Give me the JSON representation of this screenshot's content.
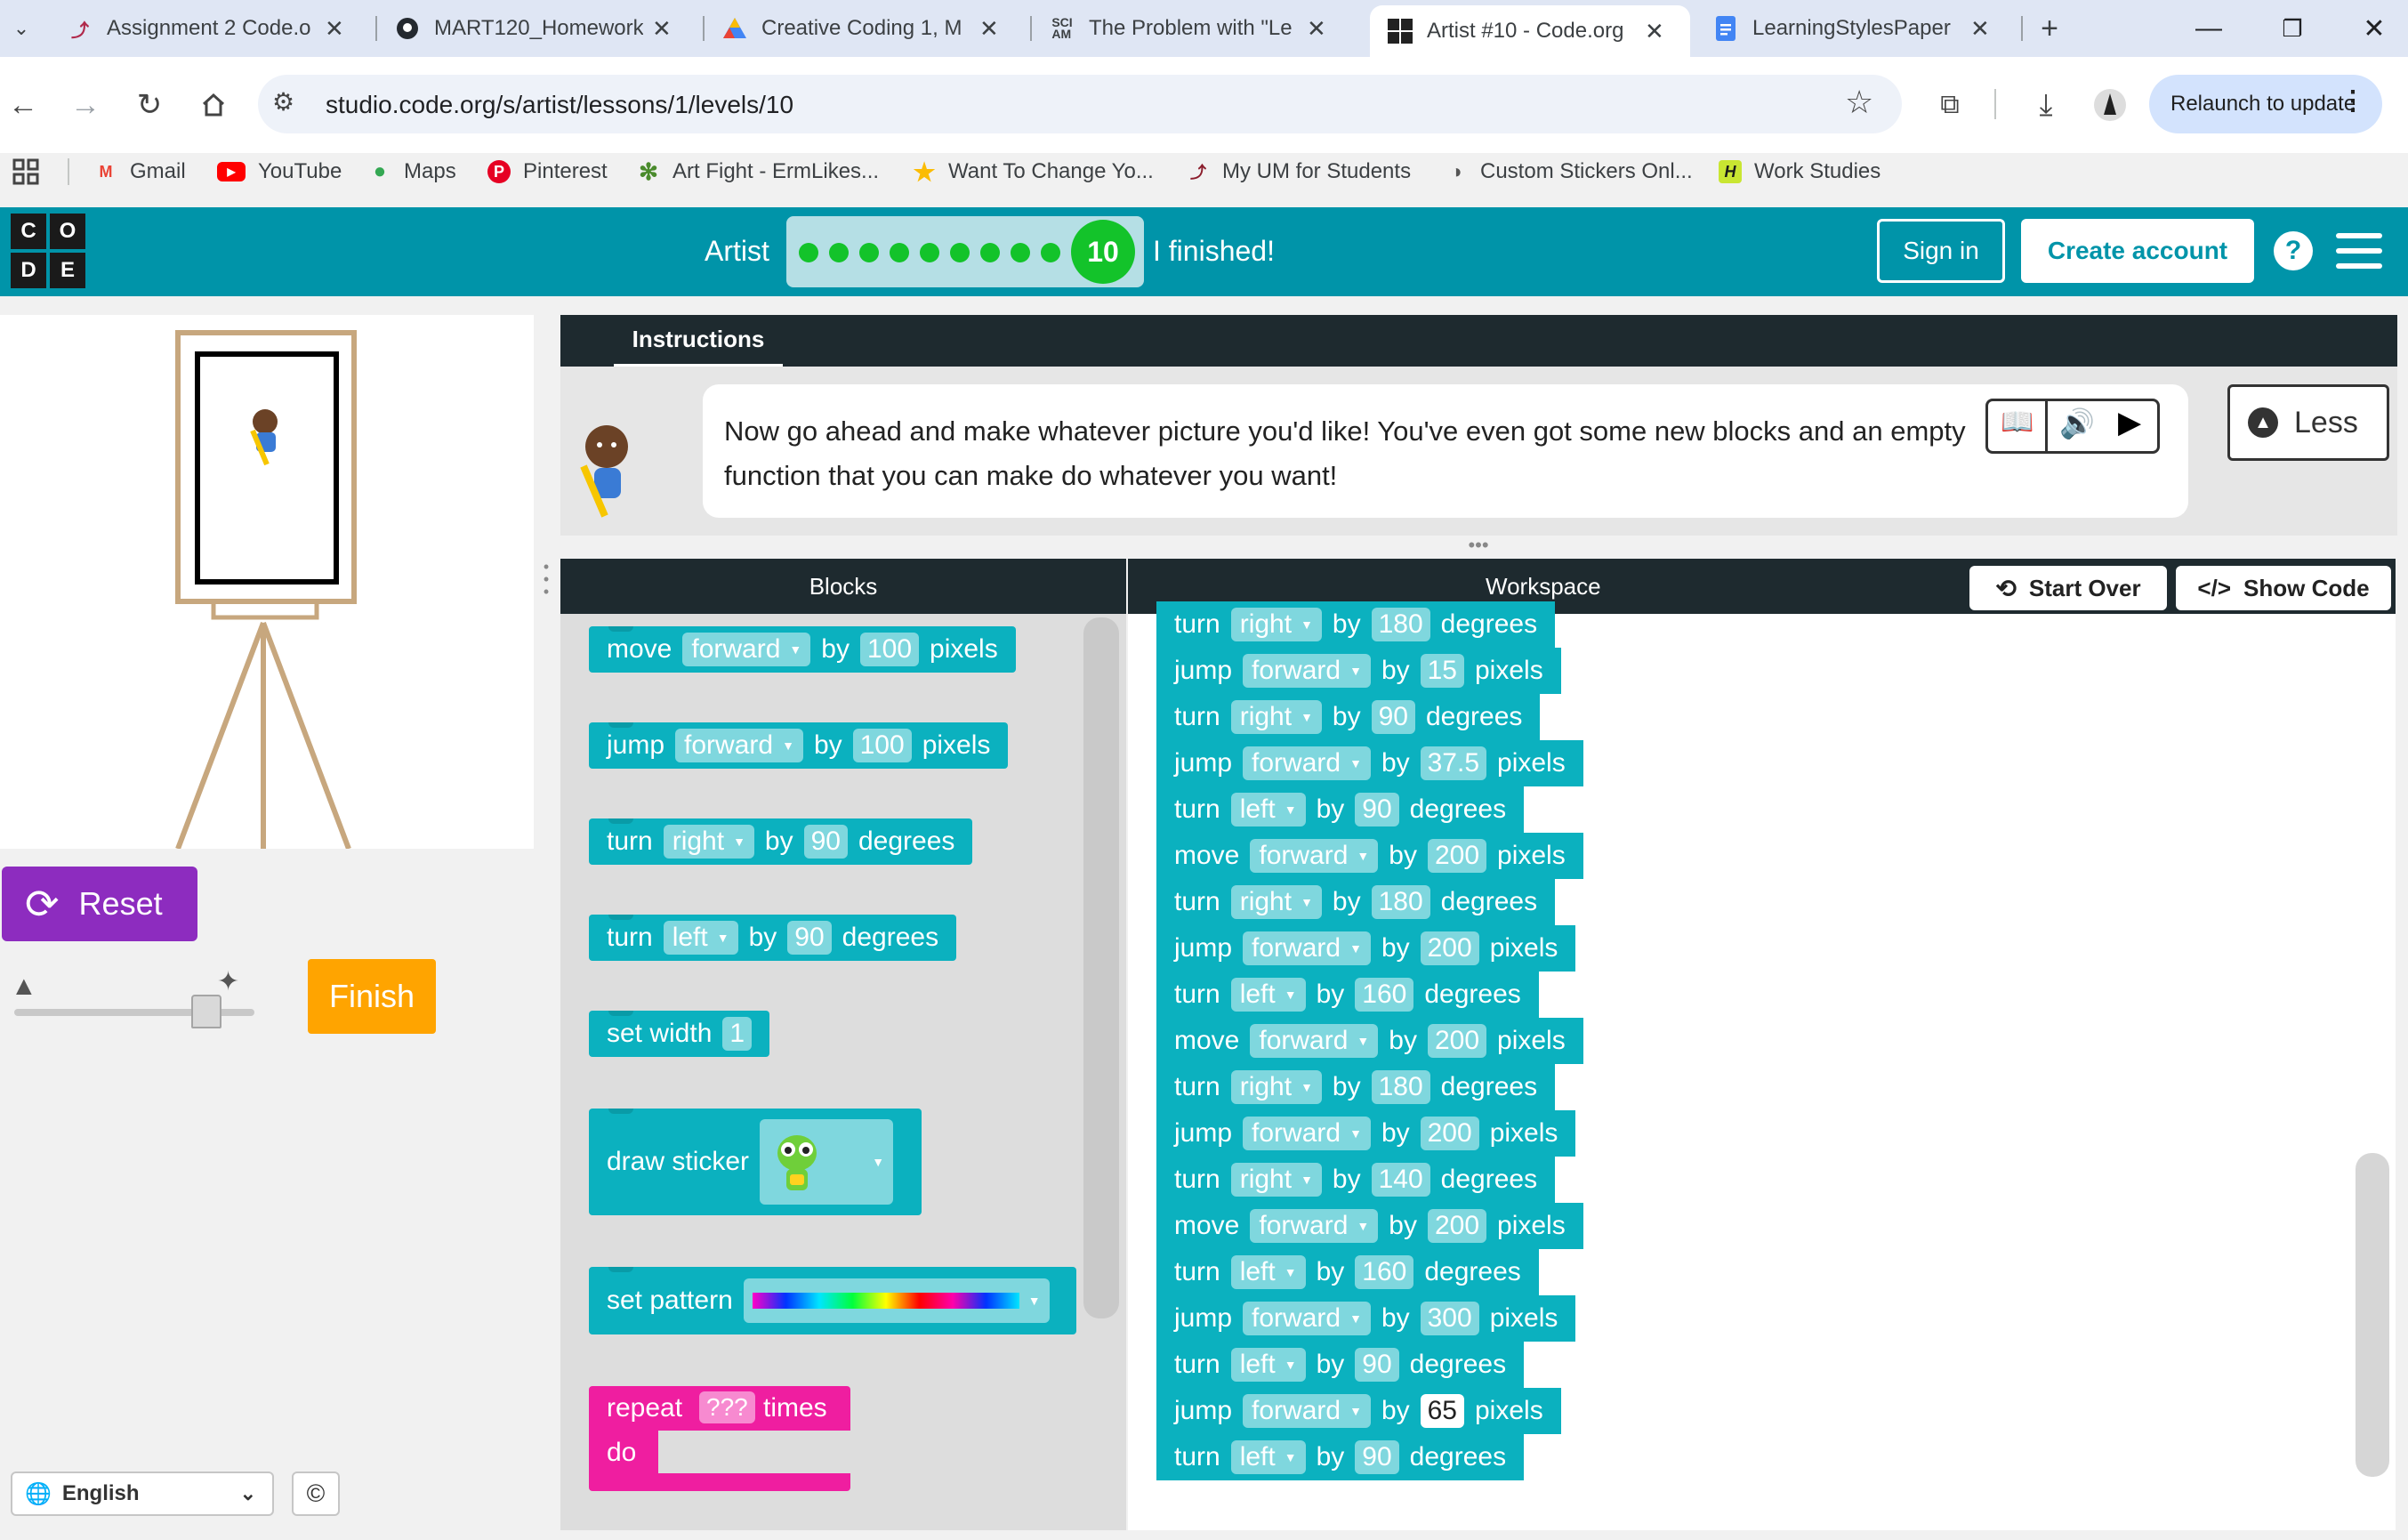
{
  "browser": {
    "tabs": [
      {
        "title": "Assignment 2 Code.o",
        "icon": "brush-icon"
      },
      {
        "title": "MART120_Homework",
        "icon": "github-icon"
      },
      {
        "title": "Creative Coding 1, M",
        "icon": "drive-icon"
      },
      {
        "title": "The Problem with \"Le",
        "icon": "sciam-icon"
      },
      {
        "title": "Artist #10 - Code.org",
        "icon": "codeorg-icon"
      },
      {
        "title": "LearningStylesPaper",
        "icon": "docs-icon"
      }
    ],
    "url": "studio.code.org/s/artist/lessons/1/levels/10",
    "relaunch_label": "Relaunch to update",
    "bookmarks": [
      "Gmail",
      "YouTube",
      "Maps",
      "Pinterest",
      "Art Fight - ErmLikes...",
      "Want To Change Yo...",
      "My UM for Students",
      "Custom Stickers Onl...",
      "Work Studies"
    ]
  },
  "header": {
    "logo": [
      "C",
      "O",
      "D",
      "E"
    ],
    "lesson": "Artist",
    "level": "10",
    "finished_text": "I finished!",
    "sign_in": "Sign in",
    "create_account": "Create account",
    "help": "?"
  },
  "left": {
    "reset_label": "Reset",
    "finish_label": "Finish",
    "speed_level": 0.8,
    "language": "English"
  },
  "instructions": {
    "tab_label": "Instructions",
    "text": "Now go ahead and make whatever picture you'd like! You've even got some new blocks and an empty function that you can make do whatever you want!",
    "less_label": "Less"
  },
  "blocks_header": "Blocks",
  "workspace_header": "Workspace",
  "start_over": "Start Over",
  "show_code": "Show Code",
  "toolbox": {
    "move": {
      "verb": "move",
      "dir": "forward",
      "by": "by",
      "value": "100",
      "unit": "pixels"
    },
    "jump": {
      "verb": "jump",
      "dir": "forward",
      "by": "by",
      "value": "100",
      "unit": "pixels"
    },
    "turn_right": {
      "verb": "turn",
      "dir": "right",
      "by": "by",
      "value": "90",
      "unit": "degrees"
    },
    "turn_left": {
      "verb": "turn",
      "dir": "left",
      "by": "by",
      "value": "90",
      "unit": "degrees"
    },
    "set_width": {
      "label": "set width",
      "value": "1"
    },
    "draw_sticker": {
      "label": "draw sticker"
    },
    "set_pattern": {
      "label": "set pattern"
    },
    "repeat": {
      "label": "repeat",
      "count": "???",
      "times": "times",
      "do": "do"
    }
  },
  "workspace_blocks": [
    {
      "verb": "turn",
      "dir": "right",
      "value": "180",
      "unit": "degrees"
    },
    {
      "verb": "jump",
      "dir": "forward",
      "value": "15",
      "unit": "pixels"
    },
    {
      "verb": "turn",
      "dir": "right",
      "value": "90",
      "unit": "degrees"
    },
    {
      "verb": "jump",
      "dir": "forward",
      "value": "37.5",
      "unit": "pixels"
    },
    {
      "verb": "turn",
      "dir": "left",
      "value": "90",
      "unit": "degrees"
    },
    {
      "verb": "move",
      "dir": "forward",
      "value": "200",
      "unit": "pixels"
    },
    {
      "verb": "turn",
      "dir": "right",
      "value": "180",
      "unit": "degrees"
    },
    {
      "verb": "jump",
      "dir": "forward",
      "value": "200",
      "unit": "pixels"
    },
    {
      "verb": "turn",
      "dir": "left",
      "value": "160",
      "unit": "degrees"
    },
    {
      "verb": "move",
      "dir": "forward",
      "value": "200",
      "unit": "pixels"
    },
    {
      "verb": "turn",
      "dir": "right",
      "value": "180",
      "unit": "degrees"
    },
    {
      "verb": "jump",
      "dir": "forward",
      "value": "200",
      "unit": "pixels"
    },
    {
      "verb": "turn",
      "dir": "right",
      "value": "140",
      "unit": "degrees"
    },
    {
      "verb": "move",
      "dir": "forward",
      "value": "200",
      "unit": "pixels"
    },
    {
      "verb": "turn",
      "dir": "left",
      "value": "160",
      "unit": "degrees"
    },
    {
      "verb": "jump",
      "dir": "forward",
      "value": "300",
      "unit": "pixels"
    },
    {
      "verb": "turn",
      "dir": "left",
      "value": "90",
      "unit": "degrees"
    },
    {
      "verb": "jump",
      "dir": "forward",
      "value": "65",
      "unit": "pixels"
    },
    {
      "verb": "turn",
      "dir": "left",
      "value": "90",
      "unit": "degrees"
    }
  ],
  "workspace_by_label": "by",
  "colors": {
    "brand_teal": "#0094a9",
    "block_teal": "#0bb1bf",
    "repeat_pink": "#ef1ea0",
    "reset_purple": "#8d2cbf",
    "finish_orange": "#ffa400",
    "progress_green": "#13c32a"
  }
}
